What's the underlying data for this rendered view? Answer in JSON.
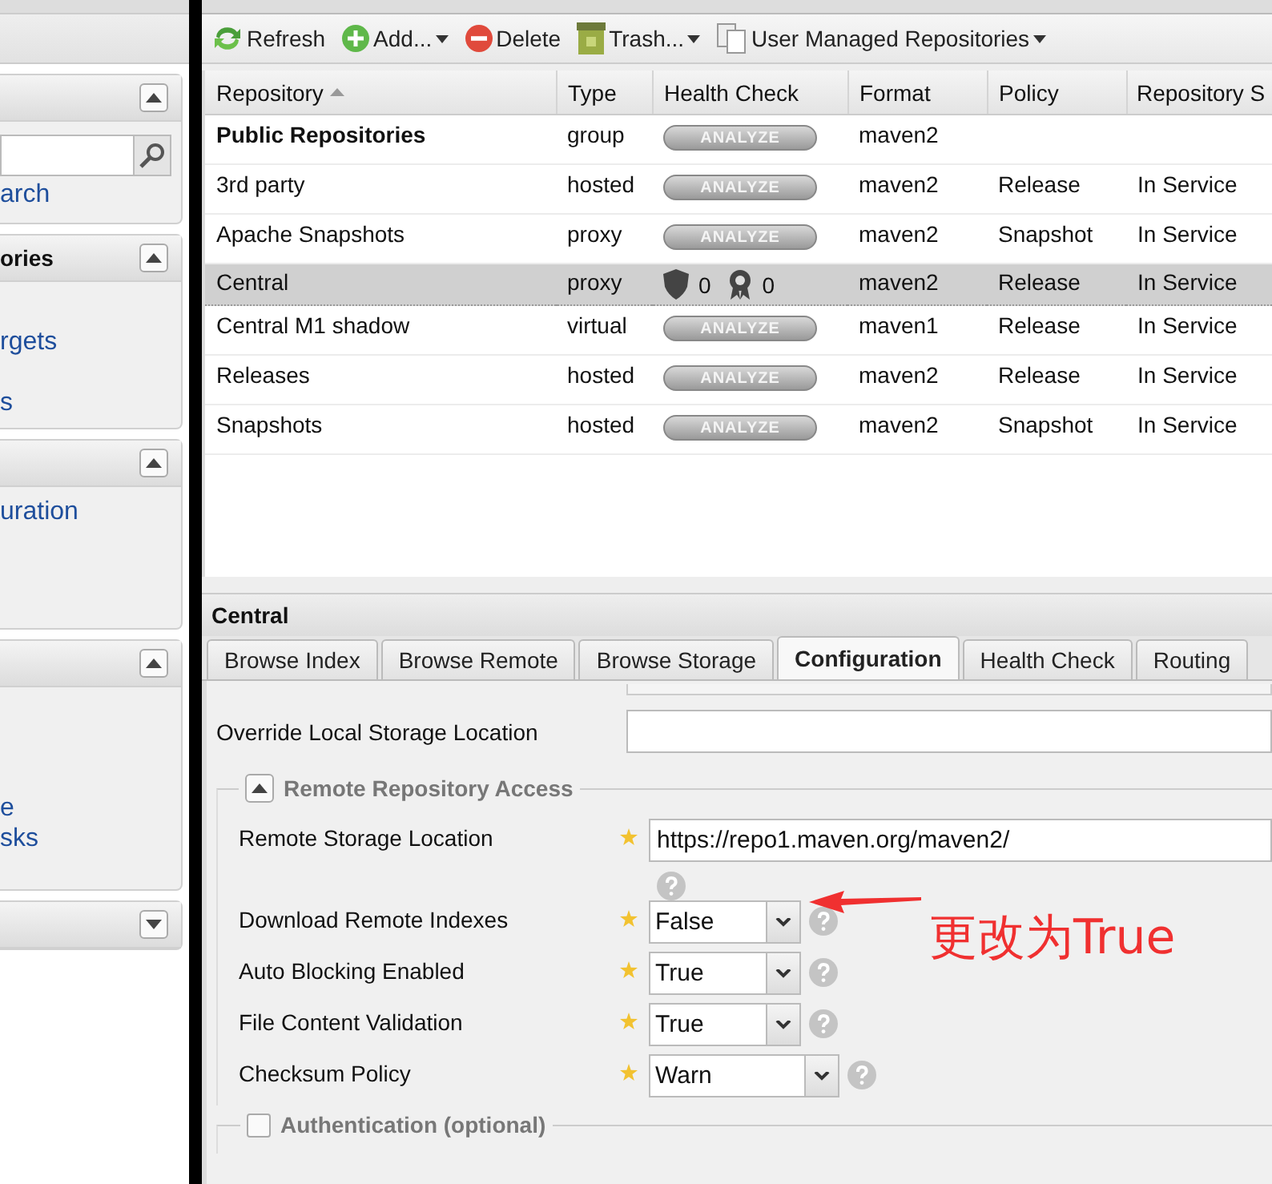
{
  "sidebar": {
    "panels": [
      {
        "expanded": true,
        "kind": "search",
        "links": [
          "arch"
        ]
      },
      {
        "title": "ories",
        "expanded": true,
        "links": [
          "rgets",
          "s"
        ]
      },
      {
        "expanded": true,
        "links": [
          "uration"
        ]
      },
      {
        "expanded": true,
        "links": [
          "e",
          "sks"
        ]
      },
      {
        "expanded": false
      }
    ]
  },
  "toolbar": [
    {
      "label": "Refresh",
      "menu": false
    },
    {
      "label": "Add...",
      "menu": true
    },
    {
      "label": "Delete",
      "menu": false
    },
    {
      "label": "Trash...",
      "menu": true
    },
    {
      "label": "User Managed Repositories",
      "menu": true
    }
  ],
  "table": {
    "columns": [
      "Repository",
      "Type",
      "Health Check",
      "Format",
      "Policy",
      "Repository S"
    ],
    "rows": [
      {
        "repository": "Public Repositories",
        "bold": true,
        "type": "group",
        "health": {
          "kind": "analyze",
          "label": "ANALYZE"
        },
        "format": "maven2",
        "selected": false
      },
      {
        "repository": "3rd party",
        "bold": false,
        "type": "hosted",
        "health": {
          "kind": "analyze",
          "label": "ANALYZE"
        },
        "format": "maven2",
        "policy": "Release",
        "status": "In Service",
        "selected": false
      },
      {
        "repository": "Apache Snapshots",
        "bold": false,
        "type": "proxy",
        "health": {
          "kind": "analyze",
          "label": "ANALYZE"
        },
        "format": "maven2",
        "policy": "Snapshot",
        "status": "In Service",
        "selected": false
      },
      {
        "repository": "Central",
        "bold": false,
        "type": "proxy",
        "health": {
          "kind": "counts",
          "security": "0",
          "license": "0"
        },
        "format": "maven2",
        "policy": "Release",
        "status": "In Service",
        "selected": true
      },
      {
        "repository": "Central M1 shadow",
        "bold": false,
        "type": "virtual",
        "health": {
          "kind": "analyze",
          "label": "ANALYZE"
        },
        "format": "maven1",
        "policy": "Release",
        "status": "In Service",
        "selected": false
      },
      {
        "repository": "Releases",
        "bold": false,
        "type": "hosted",
        "health": {
          "kind": "analyze",
          "label": "ANALYZE"
        },
        "format": "maven2",
        "policy": "Release",
        "status": "In Service",
        "selected": false
      },
      {
        "repository": "Snapshots",
        "bold": false,
        "type": "hosted",
        "health": {
          "kind": "analyze",
          "label": "ANALYZE"
        },
        "format": "maven2",
        "policy": "Snapshot",
        "status": "In Service",
        "selected": false
      }
    ]
  },
  "detail": {
    "title": "Central",
    "tabs": [
      {
        "label": "Browse Index",
        "selected": false
      },
      {
        "label": "Browse Remote",
        "selected": false
      },
      {
        "label": "Browse Storage",
        "selected": false
      },
      {
        "label": "Configuration",
        "selected": true
      },
      {
        "label": "Health Check",
        "selected": false
      },
      {
        "label": "Routing",
        "selected": false
      }
    ],
    "override_label": "Override Local Storage Location",
    "remote_section": {
      "title": "Remote Repository Access",
      "expanded": true,
      "fields": [
        {
          "kind": "text",
          "label": "Remote Storage Location",
          "value": "https://repo1.maven.org/maven2/"
        },
        {
          "kind": "select",
          "label": "Download Remote Indexes",
          "value": "False",
          "wide": false
        },
        {
          "kind": "select",
          "label": "Auto Blocking Enabled",
          "value": "True",
          "wide": false
        },
        {
          "kind": "select",
          "label": "File Content Validation",
          "value": "True",
          "wide": false
        },
        {
          "kind": "select",
          "label": "Checksum Policy",
          "value": "Warn",
          "wide": true
        }
      ]
    },
    "auth_section": {
      "title": "Authentication (optional)",
      "checked": false
    }
  },
  "annotation": {
    "text": "更改为True"
  }
}
